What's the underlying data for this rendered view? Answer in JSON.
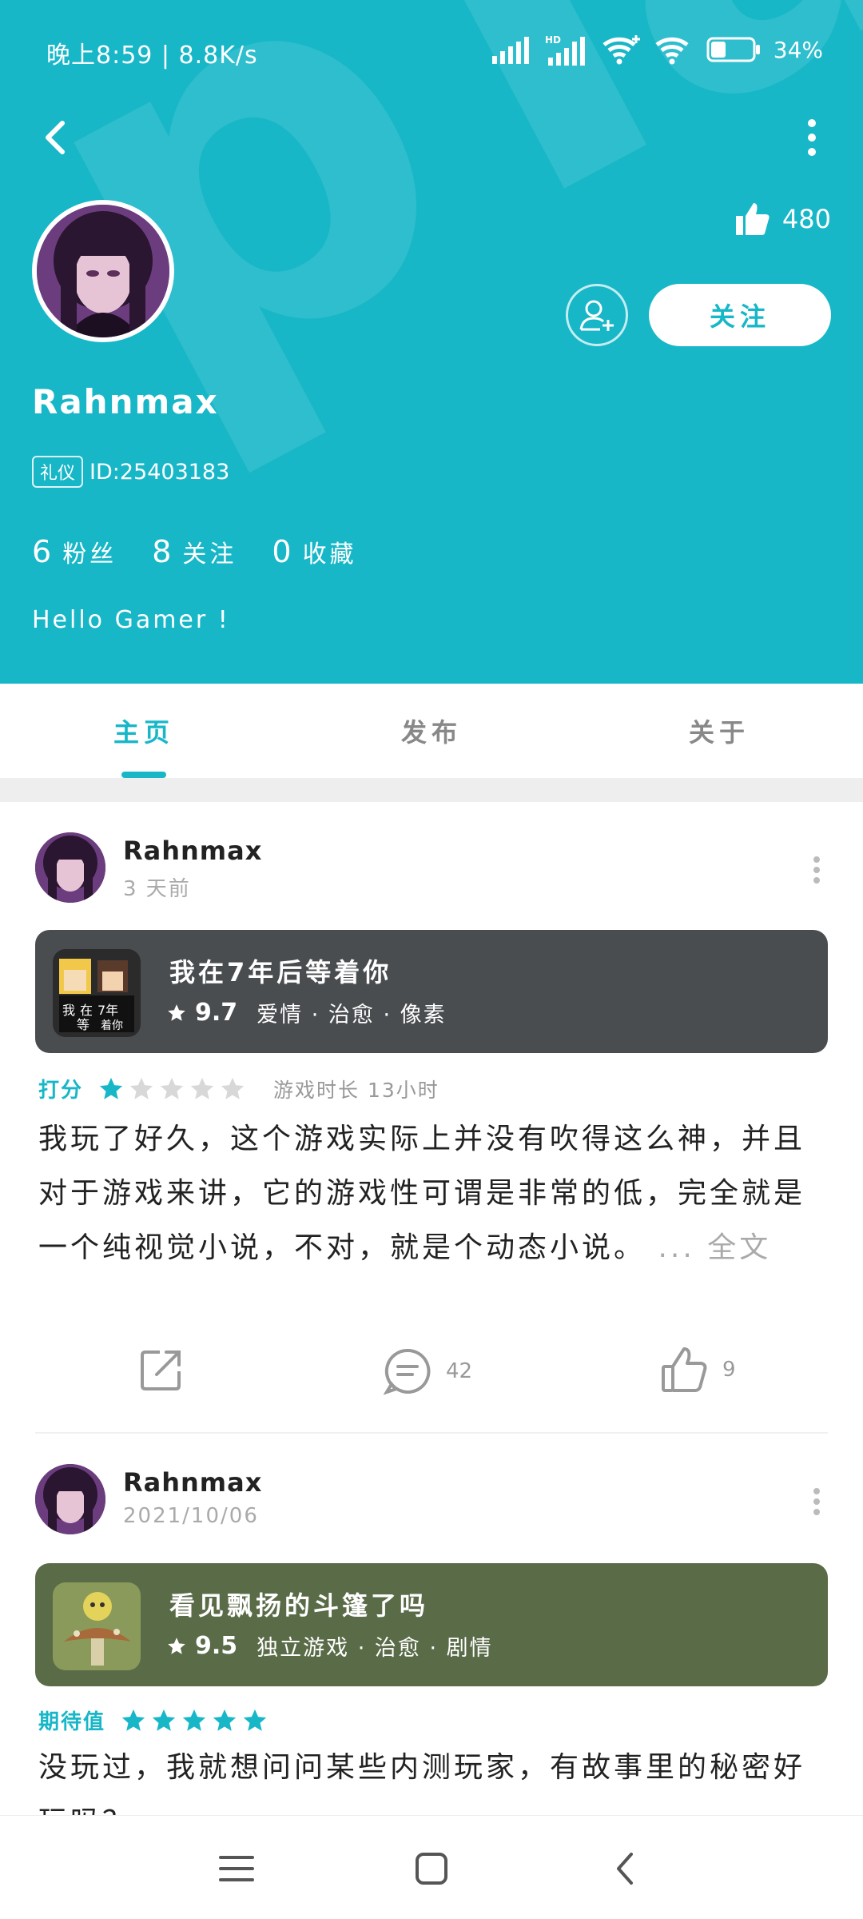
{
  "status_bar": {
    "time": "晚上8:59 | 8.8K/s",
    "battery": "34%"
  },
  "profile": {
    "username": "Rahnmax",
    "badge": "礼仪",
    "id_text": "ID:25403183",
    "likes": "480",
    "follow_label": "关注",
    "bio": "Hello Gamer !",
    "stats": [
      {
        "num": "6",
        "label": "粉丝"
      },
      {
        "num": "8",
        "label": "关注"
      },
      {
        "num": "0",
        "label": "收藏"
      }
    ]
  },
  "tabs": [
    {
      "label": "主页",
      "active": true
    },
    {
      "label": "发布",
      "active": false
    },
    {
      "label": "关于",
      "active": false
    }
  ],
  "posts": [
    {
      "user": "Rahnmax",
      "time": "3 天前",
      "game": {
        "title": "我在7年后等着你",
        "score": "9.7",
        "tags": "爱情 · 治愈 · 像素",
        "card_color": "#4a4d50"
      },
      "rating_label": "打分",
      "rating": 1,
      "playtime": "游戏时长  13小时",
      "body": "我玩了好久，这个游戏实际上并没有吹得这么神，并且对于游戏来讲，它的游戏性可谓是非常的低，完全就是一个纯视觉小说，不对，就是个动态小说。",
      "more": "... 全文",
      "comments": "42",
      "likes": "9"
    },
    {
      "user": "Rahnmax",
      "time": "2021/10/06",
      "game": {
        "title": "看见飘扬的斗篷了吗",
        "score": "9.5",
        "tags": "独立游戏 · 治愈 · 剧情",
        "card_color": "#5a6b48"
      },
      "rating_label": "期待值",
      "rating": 5,
      "body": "没玩过，我就想问问某些内测玩家，有故事里的秘密好玩吗？"
    }
  ],
  "colors": {
    "accent": "#17b7c8",
    "star_off": "#d8d8d8"
  }
}
